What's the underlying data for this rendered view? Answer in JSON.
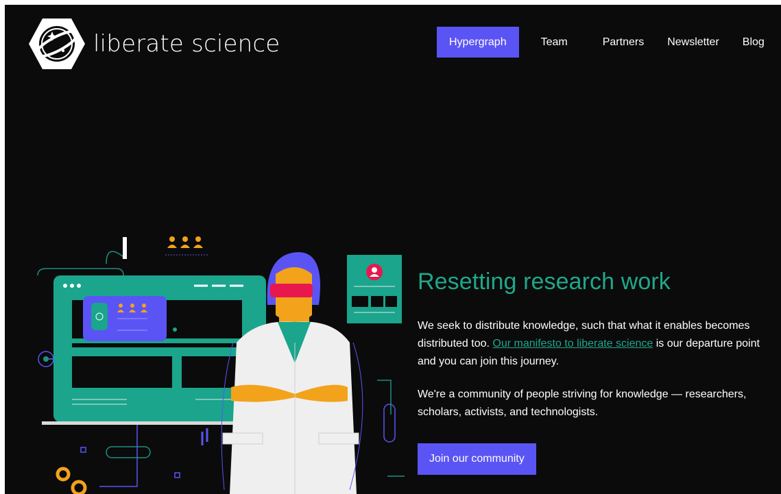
{
  "header": {
    "logo_text": "liberate science"
  },
  "nav": {
    "items": [
      {
        "label": "Hypergraph",
        "active": true
      },
      {
        "label": "Team",
        "active": false
      },
      {
        "label": "Partners",
        "active": false
      },
      {
        "label": "Newsletter",
        "active": false
      },
      {
        "label": "Blog",
        "active": false
      }
    ]
  },
  "hero": {
    "title": "Resetting research work",
    "p1_before": "We seek to distribute knowledge, such that what it enables becomes distributed too. ",
    "p1_link": "Our manifesto to liberate science",
    "p1_after": " is our departure point and you can join this journey.",
    "p2": "We're a community of people striving for knowledge — researchers, scholars, activists, and technologists.",
    "cta_label": "Join our community"
  },
  "colors": {
    "accent_purple": "#5b54f5",
    "accent_teal": "#1fa88a",
    "background": "#0b0b0c"
  },
  "icons": [
    "logo-mark-icon",
    "people-icon",
    "profile-icon",
    "gear-icon"
  ]
}
